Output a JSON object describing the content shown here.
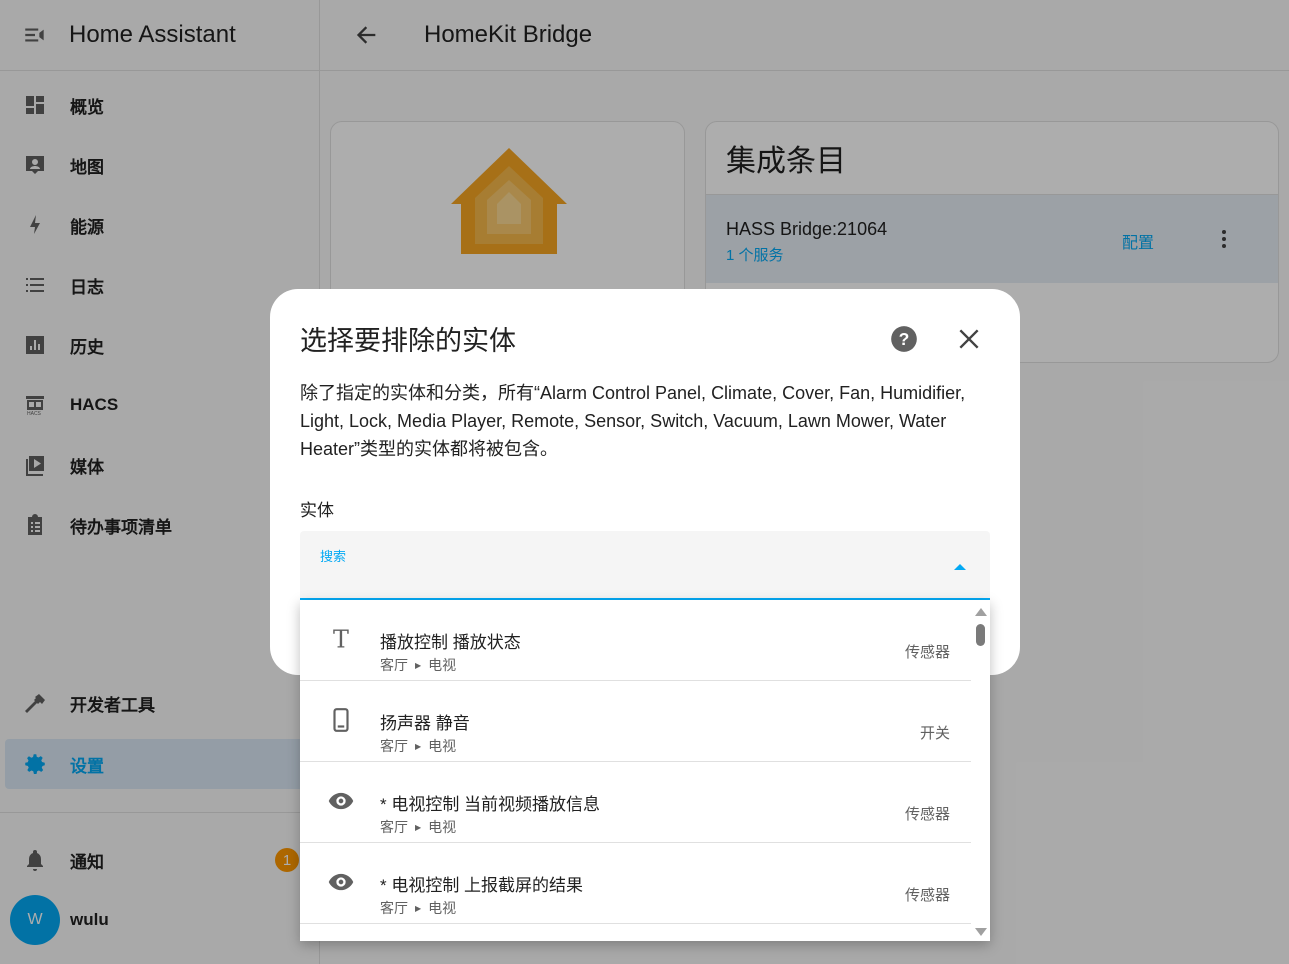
{
  "sidebar": {
    "title": "Home Assistant",
    "items": [
      {
        "label": "概览",
        "icon": "dashboard-icon"
      },
      {
        "label": "地图",
        "icon": "map-icon"
      },
      {
        "label": "能源",
        "icon": "lightning-icon"
      },
      {
        "label": "日志",
        "icon": "logbook-icon"
      },
      {
        "label": "历史",
        "icon": "history-chart-icon"
      },
      {
        "label": "HACS",
        "icon": "hacs-store-icon"
      },
      {
        "label": "媒体",
        "icon": "media-play-icon"
      },
      {
        "label": "待办事项清单",
        "icon": "clipboard-list-icon"
      }
    ],
    "dev_tools": "开发者工具",
    "settings": "设置",
    "notifications": "通知",
    "notification_count": "1",
    "user_name": "wulu",
    "user_initial": "W",
    "accent_color": "#03a9f4"
  },
  "header": {
    "title": "HomeKit Bridge"
  },
  "integration": {
    "card_title": "集成条目",
    "entry_name": "HASS Bridge:21064",
    "entry_services": "1 个服务",
    "configure": "配置"
  },
  "dialog": {
    "title": "选择要排除的实体",
    "description": "除了指定的实体和分类，所有“Alarm Control Panel, Climate, Cover, Fan, Humidifier, Light, Lock, Media Player, Remote, Sensor, Switch, Vacuum, Lawn Mower, Water Heater”类型的实体都将被包含。",
    "field_label": "实体",
    "search_label": "搜索",
    "search_value": ""
  },
  "entity_list": [
    {
      "name": "播放控制 播放状态",
      "area": "客厅",
      "device": "电视",
      "domain": "传感器",
      "icon": "text-icon"
    },
    {
      "name": "扬声器 静音",
      "area": "客厅",
      "device": "电视",
      "domain": "开关",
      "icon": "cellphone-icon"
    },
    {
      "name": "* 电视控制 当前视频播放信息",
      "area": "客厅",
      "device": "电视",
      "domain": "传感器",
      "icon": "eye-icon"
    },
    {
      "name": "* 电视控制 上报截屏的结果",
      "area": "客厅",
      "device": "电视",
      "domain": "传感器",
      "icon": "eye-icon"
    }
  ]
}
